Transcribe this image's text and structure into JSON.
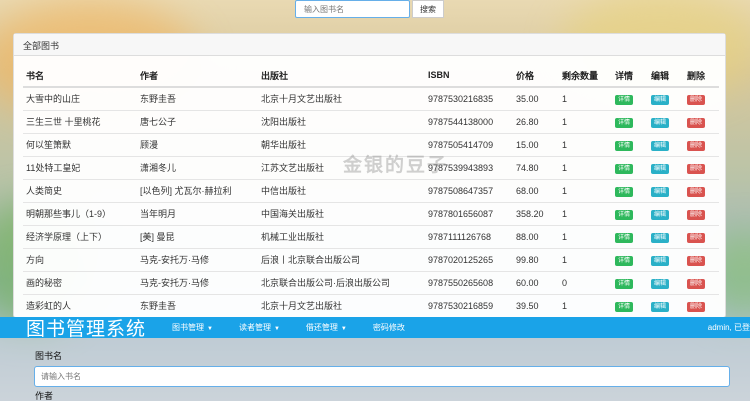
{
  "search": {
    "placeholder": "输入图书名",
    "button": "搜索"
  },
  "panel": {
    "title": "全部图书"
  },
  "table": {
    "headers": [
      "书名",
      "作者",
      "出版社",
      "ISBN",
      "价格",
      "剩余数量",
      "详情",
      "编辑",
      "删除"
    ],
    "rows": [
      [
        "大雪中的山庄",
        "东野圭吾",
        "北京十月文艺出版社",
        "9787530216835",
        "35.00",
        "1"
      ],
      [
        "三生三世 十里桃花",
        "唐七公子",
        "沈阳出版社",
        "9787544138000",
        "26.80",
        "1"
      ],
      [
        "何以笙箫默",
        "顾漫",
        "朝华出版社",
        "9787505414709",
        "15.00",
        "1"
      ],
      [
        "11处特工皇妃",
        "潇湘冬儿",
        "江苏文艺出版社",
        "9787539943893",
        "74.80",
        "1"
      ],
      [
        "人类简史",
        "[以色列] 尤瓦尔·赫拉利",
        "中信出版社",
        "9787508647357",
        "68.00",
        "1"
      ],
      [
        "明朝那些事儿（1-9）",
        "当年明月",
        "中国海关出版社",
        "9787801656087",
        "358.20",
        "1"
      ],
      [
        "经济学原理（上下）",
        "[美] 曼昆",
        "机械工业出版社",
        "9787111126768",
        "88.00",
        "1"
      ],
      [
        "方向",
        "马克-安托万·马修",
        "后浪丨北京联合出版公司",
        "9787020125265",
        "99.80",
        "1"
      ],
      [
        "画的秘密",
        "马克-安托万·马修",
        "北京联合出版公司·后浪出版公司",
        "9787550265608",
        "60.00",
        "0"
      ],
      [
        "造彩虹的人",
        "东野圭吾",
        "北京十月文艺出版社",
        "9787530216859",
        "39.50",
        "1"
      ]
    ],
    "action_labels": {
      "detail": "详情",
      "edit": "编辑",
      "delete": "删除"
    }
  },
  "watermark": "金银的豆子",
  "navbar": {
    "brand": "图书管理系统",
    "items": [
      "图书管理",
      "读者管理",
      "借还管理",
      "密码修改"
    ],
    "user": "admin, 已登"
  },
  "form": {
    "book_name_label": "图书名",
    "book_name_placeholder": "请输入书名",
    "author_label": "作者"
  },
  "colors": {
    "accent": "#1aa3e8",
    "detail": "#2eb85c",
    "edit": "#2ab0c7",
    "delete": "#d9534f"
  }
}
